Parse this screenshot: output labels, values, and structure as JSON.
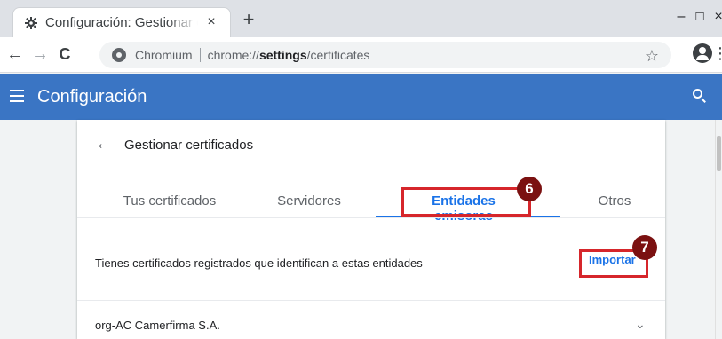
{
  "browser": {
    "tab": {
      "title": "Configuración: Gestionar certificados",
      "favicon": "gear-icon",
      "close": "×"
    },
    "new_tab": "+",
    "window_controls": {
      "minimize": "–",
      "maximize": "□",
      "close": "×"
    },
    "toolbar": {
      "back": "←",
      "forward": "→",
      "reload": "C",
      "origin": "Chromium",
      "url_scheme": "chrome://",
      "url_host": "settings",
      "url_path": "/certificates",
      "bookmark_star": "☆",
      "menu": "⋮"
    }
  },
  "settings_header": {
    "title": "Configuración"
  },
  "page": {
    "back_arrow": "←",
    "title": "Gestionar certificados",
    "tabs": [
      {
        "label": "Tus certificados"
      },
      {
        "label": "Servidores"
      },
      {
        "label": "Entidades emisoras",
        "active": true
      },
      {
        "label": "Otros"
      }
    ],
    "description": "Tienes certificados registrados que identifican a estas entidades",
    "import_label": "Importar",
    "authorities": [
      {
        "name": "org-AC Camerfirma S.A.",
        "expand_icon": "⌄"
      }
    ]
  },
  "annotations": [
    {
      "number": "6",
      "target": "Entidades emisoras"
    },
    {
      "number": "7",
      "target": "Importar"
    }
  ],
  "colors": {
    "accent": "#1a73e8",
    "header": "#3a75c4",
    "callout_border": "#d6262b",
    "callout_badge": "#7b1111"
  }
}
